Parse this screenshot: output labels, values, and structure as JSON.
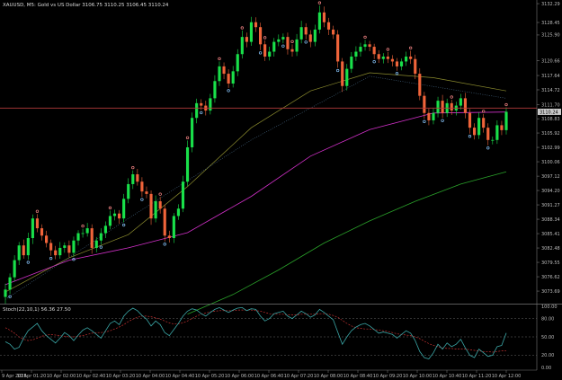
{
  "chart_data": {
    "type": "candlestick",
    "title": "XAUUSD, M5:  Gold vs US Dollar  3106.75 3110.25 3106.45 3110.24",
    "price_axis": {
      "ylim": [
        3071.5,
        3132.3
      ],
      "ticks": [
        "3132.29",
        "3128.45",
        "3125.90",
        "3120.66",
        "3117.64",
        "3114.72",
        "3111.70",
        "3108.83",
        "3105.92",
        "3102.99",
        "3100.06",
        "3097.12",
        "3094.20",
        "3091.27",
        "3088.34",
        "3085.41",
        "3082.48",
        "3079.55",
        "3076.62",
        "3073.69"
      ],
      "tick_values": [
        3132.29,
        3128.45,
        3125.9,
        3120.66,
        3117.64,
        3114.72,
        3111.7,
        3108.83,
        3105.92,
        3102.99,
        3100.06,
        3097.12,
        3094.2,
        3091.27,
        3088.34,
        3085.41,
        3082.48,
        3079.55,
        3076.62,
        3073.69
      ],
      "current_price_label": "3110.24",
      "current_price": 3110.24,
      "horizontal_line_price": 3111.0
    },
    "time_axis": {
      "labels": [
        "9 Apr 2025",
        "10 Apr 01:20",
        "10 Apr 02:00",
        "10 Apr 02:40",
        "10 Apr 03:20",
        "10 Apr 04:00",
        "10 Apr 04:40",
        "10 Apr 05:20",
        "10 Apr 06:00",
        "10 Apr 06:40",
        "10 Apr 07:20",
        "10 Apr 08:00",
        "10 Apr 08:40",
        "10 Apr 09:20",
        "10 Apr 10:00",
        "10 Apr 10:40",
        "10 Apr 11:20",
        "10 Apr 12:00"
      ]
    },
    "candles": {
      "close": [
        3074.0,
        3076.5,
        3080.0,
        3083.0,
        3081.0,
        3084.5,
        3088.5,
        3086.5,
        3085.0,
        3083.5,
        3082.0,
        3081.0,
        3082.5,
        3083.0,
        3081.5,
        3084.0,
        3085.5,
        3085.5,
        3086.5,
        3082.5,
        3084.0,
        3085.5,
        3087.0,
        3089.0,
        3089.5,
        3088.5,
        3092.5,
        3095.5,
        3097.5,
        3096.0,
        3094.0,
        3093.5,
        3088.5,
        3092.0,
        3090.5,
        3085.0,
        3084.5,
        3089.0,
        3090.5,
        3096.0,
        3103.0,
        3109.0,
        3112.0,
        3111.5,
        3110.5,
        3113.0,
        3116.5,
        3119.5,
        3118.0,
        3116.0,
        3118.5,
        3122.0,
        3125.5,
        3124.5,
        3128.5,
        3127.5,
        3124.0,
        3121.5,
        3122.5,
        3124.5,
        3125.0,
        3125.5,
        3123.0,
        3122.5,
        3125.0,
        3127.5,
        3126.0,
        3124.5,
        3127.0,
        3130.5,
        3128.5,
        3127.0,
        3126.0,
        3120.5,
        3115.5,
        3119.0,
        3121.5,
        3122.5,
        3123.5,
        3124.0,
        3123.5,
        3122.0,
        3121.0,
        3121.5,
        3121.0,
        3120.5,
        3119.5,
        3120.5,
        3121.5,
        3121.0,
        3118.0,
        3113.5,
        3110.0,
        3108.5,
        3110.0,
        3112.5,
        3110.0,
        3112.0,
        3110.5,
        3111.5,
        3113.0,
        3110.0,
        3107.0,
        3105.5,
        3109.0,
        3107.0,
        3104.5,
        3104.5,
        3107.5,
        3106.5,
        3110.24
      ],
      "open_first": 3072.5,
      "high_offsets": [
        1.2,
        0.8,
        1.0,
        0.7,
        1.2,
        1.1,
        0.8,
        0.9,
        0.8,
        1.0,
        0.7,
        0.9,
        1.2,
        0.6,
        1.0,
        0.8,
        0.6,
        0.9,
        1.1,
        0.8,
        0.7,
        1.0,
        0.9,
        1.1,
        0.8,
        0.7,
        1.0,
        1.2,
        0.8,
        1.1,
        0.9,
        1.0,
        0.7,
        1.2,
        0.9,
        0.8,
        1.0,
        0.6,
        0.9,
        1.2,
        1.4,
        1.1,
        0.9,
        0.8,
        1.0,
        0.9,
        1.2,
        1.0,
        0.8,
        0.9,
        1.1,
        1.0,
        1.3,
        0.9,
        1.1,
        1.0,
        0.9,
        0.8,
        1.0,
        0.8,
        1.0,
        0.7,
        0.9,
        1.0,
        1.1,
        1.3,
        0.8,
        0.9,
        1.0,
        1.4,
        1.2,
        0.9,
        0.8,
        0.9,
        0.7,
        1.0,
        0.9,
        1.1,
        0.8,
        0.9,
        0.7,
        0.6,
        0.8,
        0.7,
        0.9,
        0.8,
        0.7,
        0.6,
        1.0,
        1.2,
        0.9,
        1.1,
        0.8,
        0.9,
        1.0,
        0.8,
        1.2,
        0.9,
        0.7,
        0.8,
        0.9,
        1.1,
        0.8,
        0.9,
        1.1,
        0.8,
        0.9,
        0.7,
        1.0,
        0.9,
        0.9
      ],
      "low_offsets": [
        1.4,
        0.9,
        0.8,
        1.0,
        0.7,
        0.9,
        1.2,
        0.8,
        1.0,
        0.9,
        1.1,
        0.8,
        0.7,
        1.0,
        0.9,
        0.8,
        1.0,
        0.9,
        0.7,
        1.2,
        0.9,
        0.8,
        1.0,
        0.7,
        0.9,
        1.1,
        0.8,
        0.9,
        1.0,
        0.8,
        1.1,
        0.9,
        1.3,
        0.8,
        1.0,
        1.2,
        0.9,
        1.0,
        0.8,
        0.7,
        0.9,
        1.0,
        1.1,
        0.9,
        1.0,
        0.8,
        0.9,
        1.0,
        1.1,
        0.9,
        0.8,
        1.0,
        0.9,
        1.1,
        0.8,
        1.0,
        1.2,
        0.9,
        0.8,
        1.0,
        0.9,
        0.8,
        1.1,
        1.0,
        0.9,
        0.8,
        1.0,
        1.1,
        0.9,
        0.8,
        1.0,
        1.1,
        0.9,
        1.3,
        1.2,
        0.9,
        0.8,
        0.9,
        1.0,
        0.8,
        0.9,
        1.0,
        0.8,
        0.9,
        0.8,
        1.0,
        0.9,
        0.8,
        0.9,
        1.0,
        1.1,
        0.9,
        1.2,
        1.0,
        0.8,
        0.9,
        1.0,
        0.8,
        0.9,
        1.0,
        0.8,
        1.1,
        1.2,
        0.9,
        0.8,
        1.0,
        1.1,
        0.9,
        0.8,
        1.0,
        0.9
      ]
    },
    "moving_averages": [
      {
        "color": "#8b8b2e",
        "width": 0.7,
        "dash": "",
        "points": [
          [
            0,
            3073.5
          ],
          [
            14,
            3080.5
          ],
          [
            27,
            3085.2
          ],
          [
            40,
            3095.0
          ],
          [
            54,
            3107.0
          ],
          [
            67,
            3114.5
          ],
          [
            80,
            3118.2
          ],
          [
            94,
            3117.2
          ],
          [
            110,
            3114.5
          ]
        ]
      },
      {
        "color": "#d130c8",
        "width": 0.8,
        "dash": "",
        "points": [
          [
            0,
            3075.0
          ],
          [
            14,
            3080.0
          ],
          [
            27,
            3082.5
          ],
          [
            40,
            3085.6
          ],
          [
            54,
            3093.0
          ],
          [
            67,
            3101.2
          ],
          [
            80,
            3106.6
          ],
          [
            94,
            3110.0
          ],
          [
            110,
            3110.2
          ]
        ]
      },
      {
        "color": "#2aa12a",
        "width": 0.8,
        "dash": "",
        "points": [
          [
            40,
            3069.0
          ],
          [
            50,
            3073.0
          ],
          [
            60,
            3078.0
          ],
          [
            70,
            3083.5
          ],
          [
            80,
            3088.0
          ],
          [
            90,
            3092.0
          ],
          [
            100,
            3095.5
          ],
          [
            110,
            3098.0
          ]
        ]
      },
      {
        "color": "#4a6c8a",
        "width": 0.6,
        "dash": "1,1.5",
        "points": [
          [
            0,
            3072.0
          ],
          [
            27,
            3088.5
          ],
          [
            54,
            3104.5
          ],
          [
            80,
            3117.5
          ],
          [
            110,
            3113.0
          ]
        ]
      }
    ],
    "fractals": {
      "up": [
        7,
        17,
        23,
        28,
        34,
        40,
        47,
        52,
        57,
        63,
        69,
        79,
        84,
        89,
        98,
        105,
        110
      ],
      "down": [
        1,
        5,
        10,
        15,
        21,
        26,
        30,
        35,
        43,
        49,
        56,
        61,
        66,
        73,
        81,
        86,
        92,
        96,
        102,
        106
      ]
    },
    "stochastic": {
      "label": "Stoch(22,10,1) 56.36 27.50",
      "main_value_label": "56.36",
      "signal_value_label": "27.50",
      "ylim": [
        0,
        100
      ],
      "levels": [
        80,
        50,
        20
      ],
      "level_labels": [
        "100.00",
        "80.00",
        "50.00",
        "20.00",
        "0.00"
      ],
      "level_label_values": [
        100,
        80,
        50,
        20,
        0
      ],
      "main_color": "#3aa6a6",
      "signal_color": "#c23030",
      "main": [
        42,
        38,
        30,
        33,
        48,
        60,
        66,
        72,
        60,
        52,
        46,
        40,
        48,
        57,
        52,
        44,
        53,
        61,
        65,
        60,
        54,
        48,
        60,
        72,
        76,
        70,
        84,
        92,
        97,
        93,
        85,
        79,
        68,
        76,
        70,
        57,
        52,
        62,
        72,
        84,
        92,
        96,
        94,
        88,
        84,
        90,
        95,
        98,
        94,
        90,
        94,
        97,
        98,
        93,
        96,
        95,
        84,
        76,
        80,
        88,
        90,
        92,
        84,
        80,
        86,
        92,
        88,
        82,
        86,
        95,
        90,
        84,
        78,
        58,
        38,
        50,
        60,
        66,
        70,
        72,
        68,
        62,
        56,
        58,
        56,
        54,
        48,
        54,
        60,
        56,
        44,
        26,
        16,
        14,
        24,
        38,
        30,
        40,
        34,
        38,
        46,
        32,
        20,
        16,
        30,
        24,
        18,
        20,
        34,
        36,
        56.36
      ],
      "signal": [
        65,
        61,
        56,
        50,
        46,
        44,
        45,
        48,
        51,
        53,
        54,
        53,
        52,
        51,
        50,
        50,
        51,
        52,
        54,
        56,
        57,
        57,
        58,
        60,
        63,
        66,
        70,
        75,
        79,
        82,
        84,
        84,
        83,
        81,
        79,
        76,
        73,
        71,
        71,
        73,
        76,
        80,
        84,
        87,
        89,
        91,
        92,
        93,
        93,
        93,
        93,
        94,
        94,
        94,
        94,
        93,
        92,
        90,
        88,
        87,
        87,
        87,
        86,
        86,
        86,
        87,
        87,
        87,
        87,
        88,
        88,
        87,
        85,
        82,
        77,
        72,
        68,
        65,
        64,
        63,
        63,
        62,
        61,
        60,
        59,
        57,
        55,
        54,
        53,
        52,
        50,
        47,
        43,
        39,
        36,
        34,
        32,
        31,
        31,
        30,
        30,
        30,
        29,
        28,
        27,
        26,
        26,
        25,
        26,
        27,
        27.5
      ]
    }
  }
}
